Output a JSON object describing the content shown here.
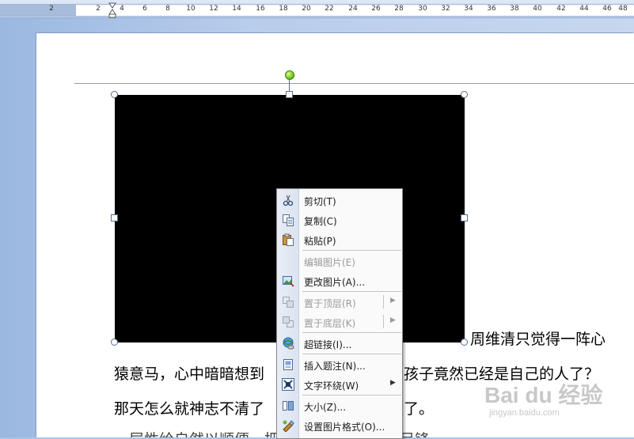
{
  "ruler": {
    "labels": [
      "2",
      "2",
      "4",
      "6",
      "8",
      "10",
      "12",
      "14",
      "16",
      "18",
      "20",
      "22",
      "24",
      "26",
      "28",
      "30",
      "32",
      "34",
      "36",
      "38",
      "40",
      "42",
      "44",
      "46",
      "48"
    ]
  },
  "document": {
    "line1": "周维清只觉得一阵心",
    "line2a": "猿意马，心中暗暗想到",
    "line2b": "孩子竟然已经是自己的人了？",
    "line3a": "那天怎么就神志不清了",
    "line3b": "了。",
    "line4": "一层性给自然以顺便一把清面的它二人只以目锋"
  },
  "context_menu": {
    "items": [
      {
        "label": "剪切(T)",
        "icon": "scissors-icon",
        "disabled": false
      },
      {
        "label": "复制(C)",
        "icon": "copy-icon",
        "disabled": false
      },
      {
        "label": "粘贴(P)",
        "icon": "paste-icon",
        "disabled": false
      },
      {
        "label": "编辑图片(E)",
        "icon": "",
        "disabled": true
      },
      {
        "label": "更改图片(A)...",
        "icon": "change-picture-icon",
        "disabled": false
      },
      {
        "label": "置于顶层(R)",
        "icon": "bring-to-front-icon",
        "disabled": true,
        "submenu": true
      },
      {
        "label": "置于底层(K)",
        "icon": "send-to-back-icon",
        "disabled": true,
        "submenu": true
      },
      {
        "label": "超链接(I)...",
        "icon": "hyperlink-icon",
        "disabled": false
      },
      {
        "label": "插入题注(N)...",
        "icon": "insert-caption-icon",
        "disabled": false
      },
      {
        "label": "文字环绕(W)",
        "icon": "text-wrap-icon",
        "disabled": false,
        "submenu": true
      },
      {
        "label": "大小(Z)...",
        "icon": "size-icon",
        "disabled": false
      },
      {
        "label": "设置图片格式(O)...",
        "icon": "format-picture-icon",
        "disabled": false
      }
    ]
  },
  "watermark": {
    "main": "Bai du 经验",
    "sub": "jingyan.baidu.com"
  },
  "colors": {
    "image_fill": "#000000",
    "rotation_handle": "#5fbf17",
    "menu_border": "#868686"
  }
}
